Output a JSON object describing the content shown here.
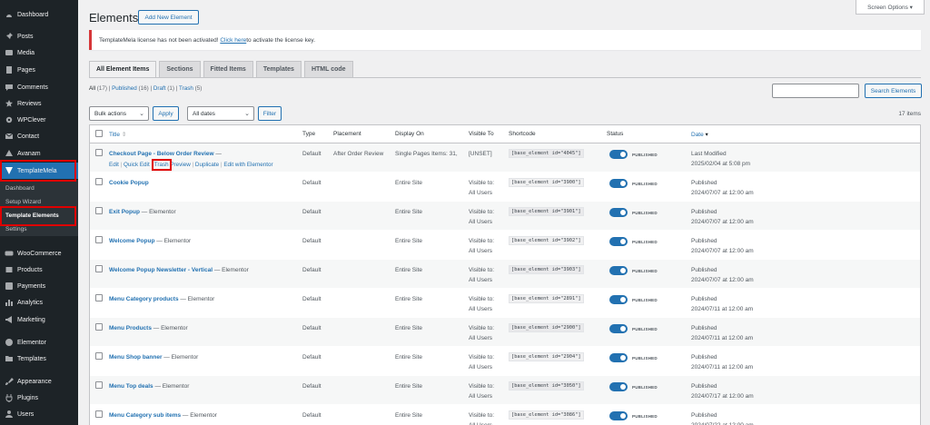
{
  "sidebar": {
    "items": [
      {
        "label": "Dashboard",
        "icon": "dashboard-icon"
      },
      {
        "label": "Posts",
        "icon": "pin-icon"
      },
      {
        "label": "Media",
        "icon": "media-icon"
      },
      {
        "label": "Pages",
        "icon": "pages-icon"
      },
      {
        "label": "Comments",
        "icon": "comment-icon"
      },
      {
        "label": "Reviews",
        "icon": "star-icon"
      },
      {
        "label": "WPClever",
        "icon": "gear-icon"
      },
      {
        "label": "Contact",
        "icon": "mail-icon"
      },
      {
        "label": "Avanam",
        "icon": "avanam-icon"
      },
      {
        "label": "TemplateMela",
        "icon": "templatemela-icon"
      },
      {
        "label": "WooCommerce",
        "icon": "woo-icon"
      },
      {
        "label": "Products",
        "icon": "box-icon"
      },
      {
        "label": "Payments",
        "icon": "dollar-icon"
      },
      {
        "label": "Analytics",
        "icon": "bar-chart-icon"
      },
      {
        "label": "Marketing",
        "icon": "megaphone-icon"
      },
      {
        "label": "Elementor",
        "icon": "elementor-icon"
      },
      {
        "label": "Templates",
        "icon": "folder-icon"
      },
      {
        "label": "Appearance",
        "icon": "brush-icon"
      },
      {
        "label": "Plugins",
        "icon": "plug-icon"
      },
      {
        "label": "Users",
        "icon": "user-icon"
      }
    ],
    "submenu": [
      "Dashboard",
      "Setup Wizard",
      "Template Elements",
      "Settings"
    ]
  },
  "header": {
    "title": "Elements",
    "add_new": "Add New Element",
    "screen_options": "Screen Options ▾"
  },
  "notice": {
    "text": "TemplateMela license has not been activated! ",
    "link": "Click here",
    "text_after": " to activate the license key."
  },
  "tabs": [
    "All Element Items",
    "Sections",
    "Fitted Items",
    "Templates",
    "HTML code"
  ],
  "filters": {
    "all": "All",
    "all_count": " (17) | ",
    "published": "Published",
    "published_count": " (16) | ",
    "draft": "Draft",
    "draft_count": " (1) | ",
    "trash": "Trash",
    "trash_count": " (5)"
  },
  "toolbar": {
    "bulk_actions": "Bulk actions",
    "apply": "Apply",
    "all_dates": "All dates",
    "filter": "Filter",
    "search_button": "Search Elements",
    "search_placeholder": "",
    "items_count": "17 items"
  },
  "table": {
    "columns": [
      "Title",
      "Type",
      "Placement",
      "Display On",
      "Visible To",
      "Shortcode",
      "Status",
      "Date"
    ],
    "row_actions": [
      "Edit",
      "Quick Edit",
      "Trash",
      "Preview",
      "Duplicate",
      "Edit with Elementor"
    ],
    "rows": [
      {
        "title": "Checkout Page - Below Order Review",
        "suffix": " —",
        "type": "Default",
        "placement": "After Order Review",
        "display": "Single Pages Items: 31,",
        "visible1": "[UNSET]",
        "visible2": "",
        "shortcode": "[base_element id=\"4045\"]",
        "status": "PUBLISHED",
        "date1": "Last Modified",
        "date2": "2025/02/04 at 5:08 pm"
      },
      {
        "title": "Cookie Popup",
        "suffix": "",
        "type": "Default",
        "placement": "",
        "display": "Entire Site",
        "visible1": "Visible to:",
        "visible2": "All Users",
        "shortcode": "[base_element id=\"3900\"]",
        "status": "PUBLISHED",
        "date1": "Published",
        "date2": "2024/07/07 at 12:00 am"
      },
      {
        "title": "Exit Popup",
        "suffix": " — Elementor",
        "type": "Default",
        "placement": "",
        "display": "Entire Site",
        "visible1": "Visible to:",
        "visible2": "All Users",
        "shortcode": "[base_element id=\"3901\"]",
        "status": "PUBLISHED",
        "date1": "Published",
        "date2": "2024/07/07 at 12:00 am"
      },
      {
        "title": "Welcome Popup",
        "suffix": " — Elementor",
        "type": "Default",
        "placement": "",
        "display": "Entire Site",
        "visible1": "Visible to:",
        "visible2": "All Users",
        "shortcode": "[base_element id=\"3902\"]",
        "status": "PUBLISHED",
        "date1": "Published",
        "date2": "2024/07/07 at 12:00 am"
      },
      {
        "title": "Welcome Popup Newsletter - Vertical",
        "suffix": " — Elementor",
        "type": "Default",
        "placement": "",
        "display": "Entire Site",
        "visible1": "Visible to:",
        "visible2": "All Users",
        "shortcode": "[base_element id=\"3903\"]",
        "status": "PUBLISHED",
        "date1": "Published",
        "date2": "2024/07/07 at 12:00 am"
      },
      {
        "title": "Menu Category products",
        "suffix": " — Elementor",
        "type": "Default",
        "placement": "",
        "display": "Entire Site",
        "visible1": "Visible to:",
        "visible2": "All Users",
        "shortcode": "[base_element id=\"2891\"]",
        "status": "PUBLISHED",
        "date1": "Published",
        "date2": "2024/07/11 at 12:00 am"
      },
      {
        "title": "Menu Products",
        "suffix": " — Elementor",
        "type": "Default",
        "placement": "",
        "display": "Entire Site",
        "visible1": "Visible to:",
        "visible2": "All Users",
        "shortcode": "[base_element id=\"2900\"]",
        "status": "PUBLISHED",
        "date1": "Published",
        "date2": "2024/07/11 at 12:00 am"
      },
      {
        "title": "Menu Shop banner",
        "suffix": " — Elementor",
        "type": "Default",
        "placement": "",
        "display": "Entire Site",
        "visible1": "Visible to:",
        "visible2": "All Users",
        "shortcode": "[base_element id=\"2904\"]",
        "status": "PUBLISHED",
        "date1": "Published",
        "date2": "2024/07/11 at 12:00 am"
      },
      {
        "title": "Menu Top deals",
        "suffix": " — Elementor",
        "type": "Default",
        "placement": "",
        "display": "Entire Site",
        "visible1": "Visible to:",
        "visible2": "All Users",
        "shortcode": "[base_element id=\"3050\"]",
        "status": "PUBLISHED",
        "date1": "Published",
        "date2": "2024/07/17 at 12:00 am"
      },
      {
        "title": "Menu Category sub items",
        "suffix": " — Elementor",
        "type": "Default",
        "placement": "",
        "display": "Entire Site",
        "visible1": "Visible to:",
        "visible2": "All Users",
        "shortcode": "[base_element id=\"3086\"]",
        "status": "PUBLISHED",
        "date1": "Published",
        "date2": "2024/07/22 at 12:00 am"
      }
    ]
  },
  "colors": {
    "accent": "#2271b1",
    "sidebar": "#1d2327",
    "highlight": "#e00000"
  }
}
